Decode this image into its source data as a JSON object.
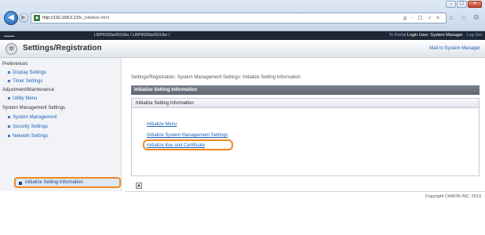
{
  "browser": {
    "address_prefix": "http://192.168.0.215",
    "address_path": "/_initialize.html",
    "address_tools": "ρ - ☐ ♂ ×",
    "window_controls": [
      "–",
      "☐",
      "✕"
    ]
  },
  "header": {
    "model": "LBP6030w/6018w / LBP6030w/6018w /",
    "portal_link": "To Portal",
    "login_user": "Login User: System Manager",
    "logout": "Log Out"
  },
  "title_bar": {
    "title": "Settings/Registration",
    "mail_link": "Mail to System Manager"
  },
  "sidebar": {
    "items": [
      {
        "label": "Preferences",
        "type": "heading"
      },
      {
        "label": "Display Settings",
        "type": "link"
      },
      {
        "label": "Timer Settings",
        "type": "link"
      },
      {
        "label": "Adjustment/Maintenance",
        "type": "heading"
      },
      {
        "label": "Utility Menu",
        "type": "link"
      },
      {
        "label": "System Management Settings",
        "type": "heading"
      },
      {
        "label": "System Management",
        "type": "link"
      },
      {
        "label": "Security Settings",
        "type": "link"
      },
      {
        "label": "Network Settings",
        "type": "link"
      }
    ],
    "active_item": "Initialize Setting Information"
  },
  "main": {
    "breadcrumb": "Settings/Registration: System Management Settings: Initialize Setting Information",
    "section_title": "Initialize Setting Information",
    "panel_title": "Initialize Setting Information",
    "links": [
      "Initialize Menu",
      "Initialize System Management Settings",
      "Initialize Key and Certificate"
    ],
    "collapse_symbol": "▲",
    "copyright": "Copyright CANON INC. 2013"
  }
}
